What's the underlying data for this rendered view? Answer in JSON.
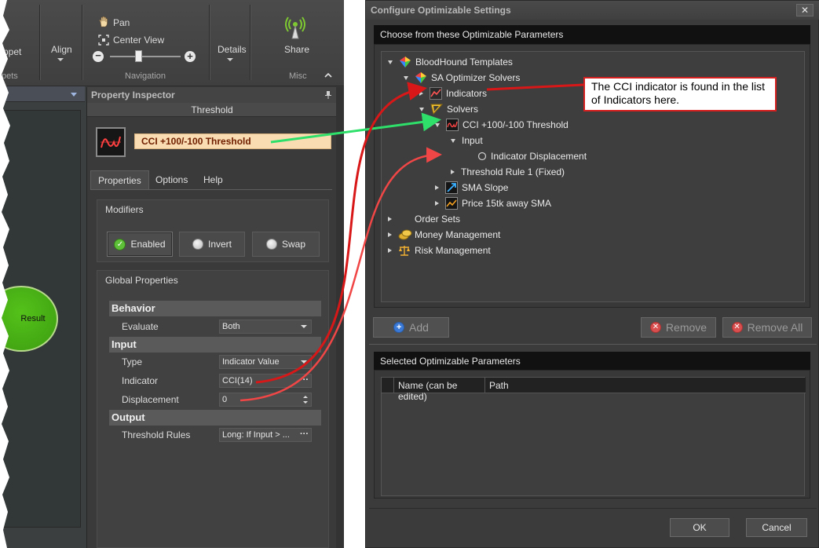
{
  "ribbon": {
    "snippet_label": "ppet",
    "snippets_group": "pets",
    "align_label": "Align",
    "pan_label": "Pan",
    "center_view_label": "Center View",
    "navigation_group": "Navigation",
    "details_label": "Details",
    "share_label": "Share",
    "misc_group": "Misc",
    "zoom_out": "−",
    "zoom_in": "+"
  },
  "canvas": {
    "result_label": "Result"
  },
  "property_inspector": {
    "header": "Property Inspector",
    "title": "Threshold",
    "block_name": "CCI +100/-100 Threshold",
    "tabs": [
      "Properties",
      "Options",
      "Help"
    ],
    "active_tab": "Properties",
    "modifiers": {
      "title": "Modifiers",
      "buttons": [
        {
          "label": "Enabled",
          "state": "on"
        },
        {
          "label": "Invert",
          "state": "off"
        },
        {
          "label": "Swap",
          "state": "off"
        }
      ]
    },
    "global_properties": {
      "title": "Global Properties",
      "categories": [
        {
          "name": "Behavior",
          "props": [
            {
              "label": "Evaluate",
              "value": "Both",
              "editor": "dropdown"
            }
          ]
        },
        {
          "name": "Input",
          "props": [
            {
              "label": "Type",
              "value": "Indicator Value",
              "editor": "dropdown"
            },
            {
              "label": "Indicator",
              "value": "CCI(14)",
              "editor": "ellipsis"
            },
            {
              "label": "Displacement",
              "value": "0",
              "editor": "spinner"
            }
          ]
        },
        {
          "name": "Output",
          "props": [
            {
              "label": "Threshold Rules",
              "value": "Long: If Input > ...",
              "editor": "ellipsis"
            }
          ]
        }
      ]
    }
  },
  "dialog": {
    "title": "Configure Optimizable Settings",
    "close": "✕",
    "choose_header": "Choose from these Optimizable Parameters",
    "tree": [
      {
        "label": "BloodHound Templates",
        "icon": "templates-icon",
        "depth": 0,
        "expander": "expanded"
      },
      {
        "label": "SA Optimizer Solvers",
        "icon": "templates-icon",
        "depth": 1,
        "expander": "expanded"
      },
      {
        "label": "Indicators",
        "icon": "indicators-icon",
        "depth": 2,
        "expander": "collapsed"
      },
      {
        "label": "Solvers",
        "icon": "solvers-icon",
        "depth": 2,
        "expander": "expanded"
      },
      {
        "label": "CCI +100/-100 Threshold",
        "icon": "threshold-icon",
        "depth": 3,
        "expander": "expanded"
      },
      {
        "label": "Input",
        "icon": "",
        "depth": 4,
        "expander": "expanded"
      },
      {
        "label": "Indicator Displacement",
        "icon": "radio-icon",
        "depth": 5,
        "expander": "none"
      },
      {
        "label": "Threshold Rule 1 (Fixed)",
        "icon": "",
        "depth": 4,
        "expander": "collapsed"
      },
      {
        "label": "SMA Slope",
        "icon": "slope-icon",
        "depth": 3,
        "expander": "collapsed"
      },
      {
        "label": "Price 15tk away SMA",
        "icon": "price-icon",
        "depth": 3,
        "expander": "collapsed"
      },
      {
        "label": "Order Sets",
        "icon": "",
        "depth": 0,
        "expander": "collapsed"
      },
      {
        "label": "Money Management",
        "icon": "money-icon",
        "depth": 0,
        "expander": "collapsed"
      },
      {
        "label": "Risk Management",
        "icon": "scales-icon",
        "depth": 0,
        "expander": "collapsed"
      }
    ],
    "add_label": "Add",
    "remove_label": "Remove",
    "remove_all_label": "Remove All",
    "selected_header": "Selected Optimizable Parameters",
    "columns": [
      "Name (can be edited)",
      "Path"
    ],
    "ok_label": "OK",
    "cancel_label": "Cancel"
  },
  "annotation": {
    "callout_text": "The CCI indicator is found in the list of Indicators here.",
    "colors": {
      "red": "#d81818",
      "green": "#2ee06a",
      "light_red": "#f04646"
    }
  }
}
